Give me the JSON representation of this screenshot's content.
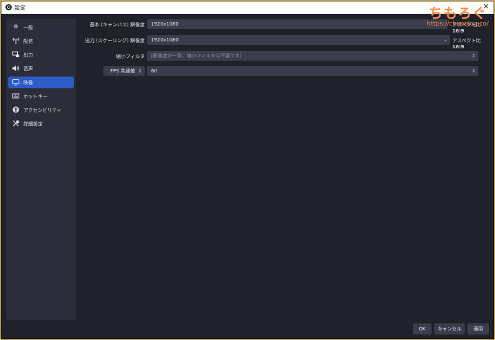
{
  "window": {
    "title": "設定",
    "close": "✕"
  },
  "watermark": {
    "title": "ちもろぐ",
    "url": "https://chimolog.co/"
  },
  "sidebar": {
    "items": [
      {
        "label": "一般",
        "icon": "gear-icon"
      },
      {
        "label": "配信",
        "icon": "antenna-icon"
      },
      {
        "label": "出力",
        "icon": "output-icon"
      },
      {
        "label": "音声",
        "icon": "speaker-icon"
      },
      {
        "label": "映像",
        "icon": "monitor-icon",
        "selected": true
      },
      {
        "label": "ホットキー",
        "icon": "keyboard-icon"
      },
      {
        "label": "アクセシビリティ",
        "icon": "accessibility-icon"
      },
      {
        "label": "詳細設定",
        "icon": "wrench-icon"
      }
    ]
  },
  "video": {
    "base_label": "基本 (キャンバス) 解像度",
    "base_value": "1920x1080",
    "base_aspect_label": "アスペクト比",
    "base_aspect_value": "16:9",
    "output_label": "出力 (スケーリング) 解像度",
    "output_value": "1920x1080",
    "output_aspect_label": "アスペクト比",
    "output_aspect_value": "16:9",
    "filter_label": "縮小フィルタ",
    "filter_value": "[解像度が一致、縮小フィルタは不要です]",
    "fps_label": "FPS 共通値",
    "fps_value": "60"
  },
  "buttons": {
    "ok": "OK",
    "cancel": "キャンセル",
    "apply": "適用"
  }
}
